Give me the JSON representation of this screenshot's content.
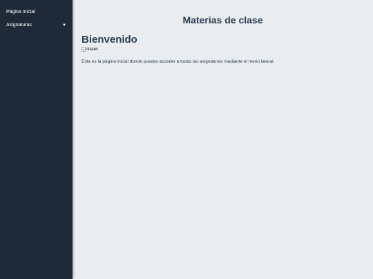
{
  "sidebar": {
    "items": [
      {
        "label": "Página Inicial"
      },
      {
        "label": "Asignaturas",
        "caret": "▼"
      }
    ]
  },
  "main": {
    "title": "Materias de clase",
    "heading": "Bienvenido",
    "image_alt": "clases",
    "intro": "Esta es la página inicial donde puedes acceder a todas las asignaturas mediante el menú lateral."
  },
  "colors": {
    "sidebar_bg": "#1e2a38",
    "page_bg": "#e9edf0",
    "heading_text": "#2c3e50"
  }
}
